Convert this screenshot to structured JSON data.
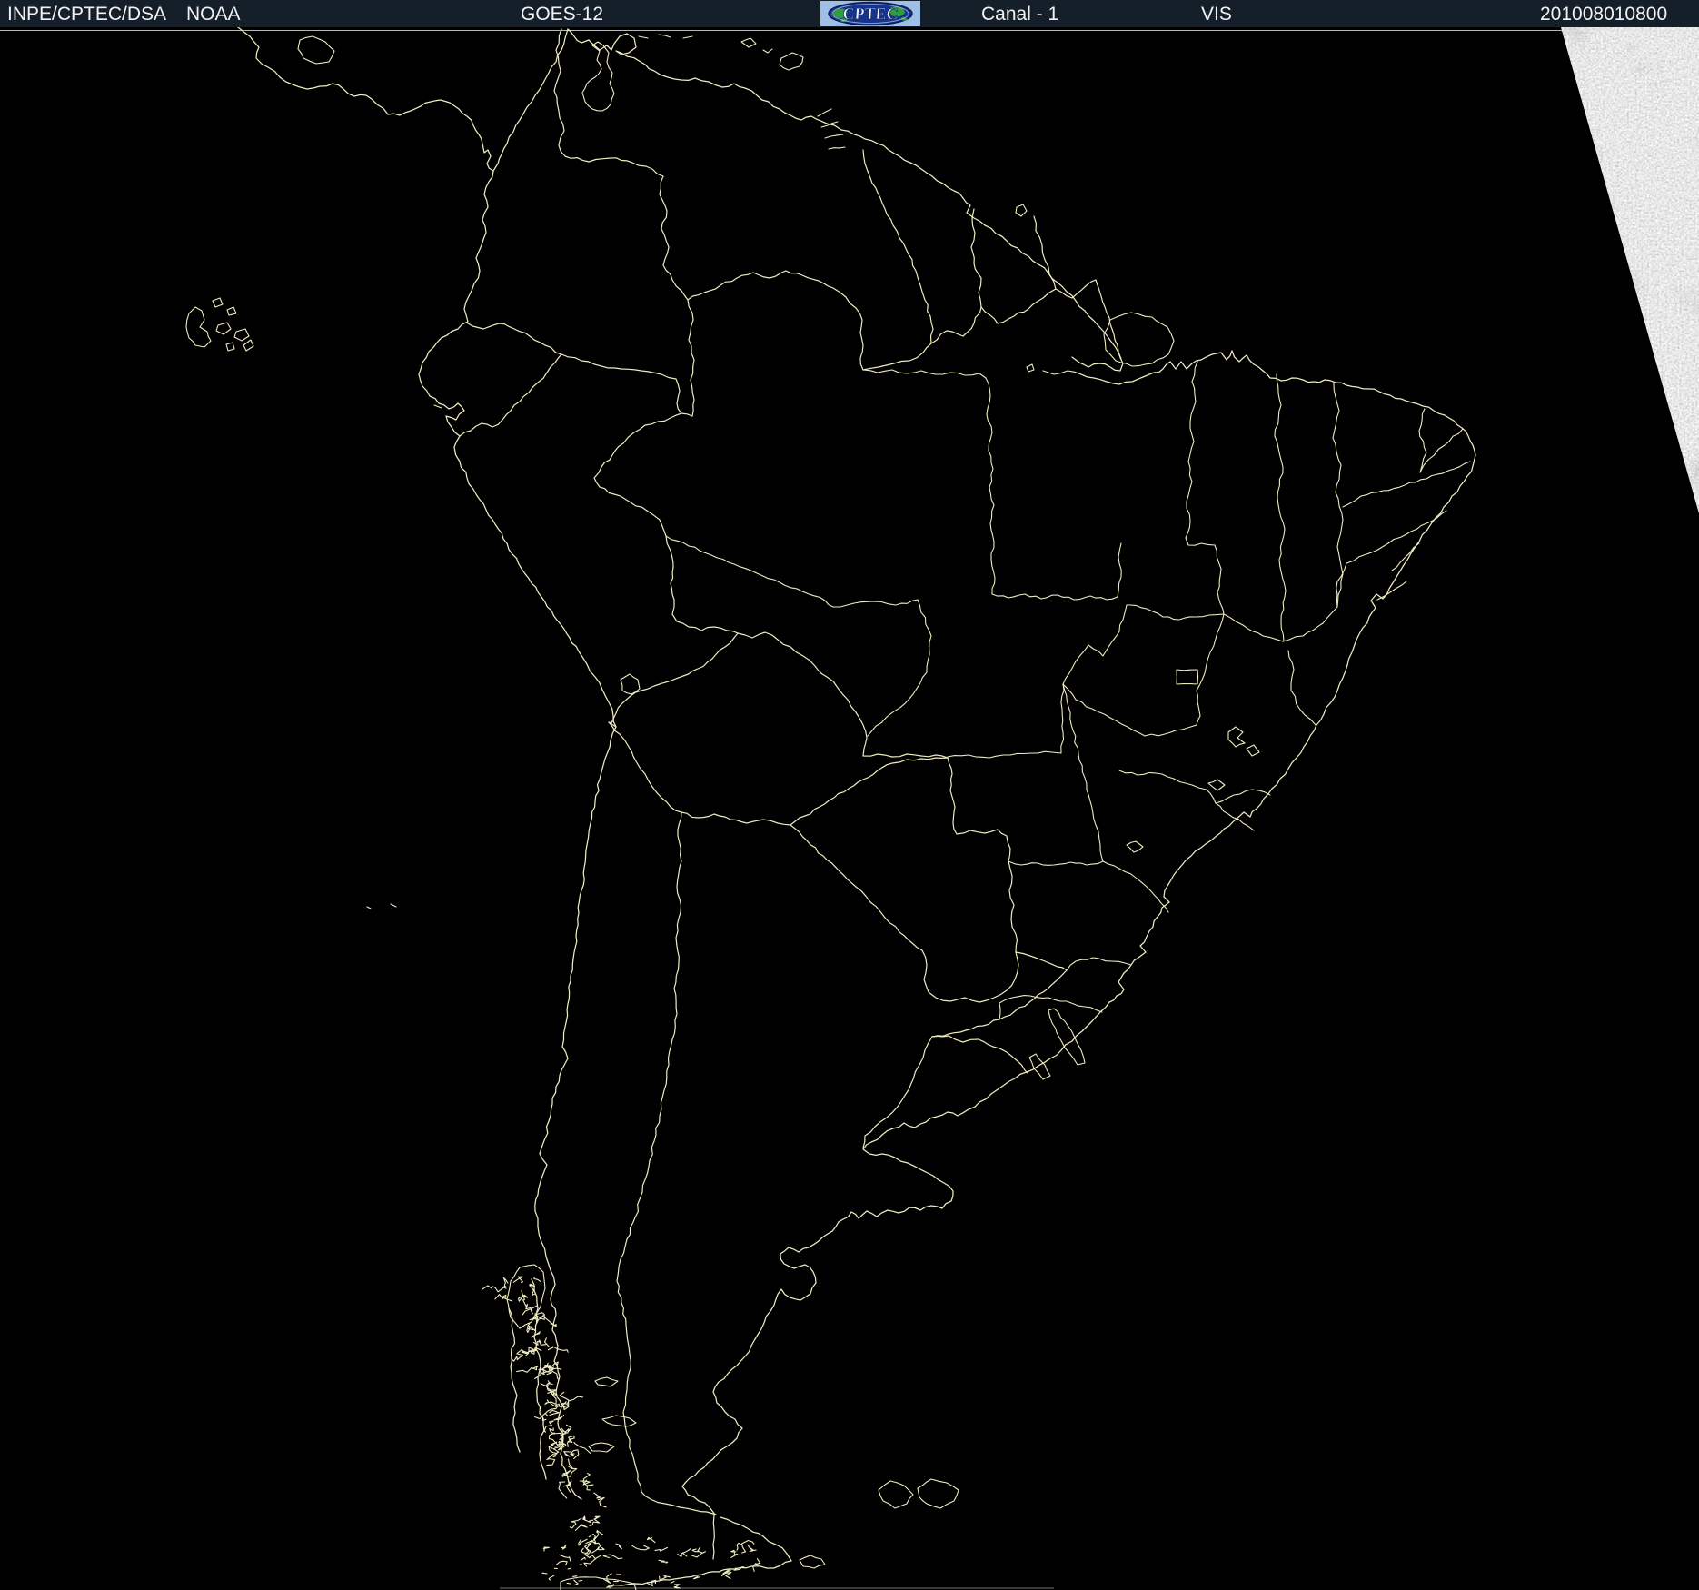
{
  "header": {
    "left_label": "INPE/CPTEC/DSA",
    "agency": "NOAA",
    "satellite": "GOES-12",
    "logo_text": "CPTEC",
    "channel_label": "Canal - 1",
    "band_label": "VIS",
    "timestamp": "201008010800",
    "colors": {
      "background": "#141f2a",
      "text": "#f2f2f2",
      "logo_background": "#a0bfe4",
      "logo_globe": "#16338f",
      "logo_land": "#2f9e3f",
      "logo_letters": "#f0f2f8"
    }
  },
  "map": {
    "region": "South America",
    "colors": {
      "background": "#000000",
      "boundary_lines": "#f0ecc2",
      "sunlit_clouds": "#c9c9c9"
    },
    "description": "Night-time visible-channel satellite view: black disk with country and Brazilian state boundary overlay; sunlit cloud field only in upper-right corner"
  }
}
